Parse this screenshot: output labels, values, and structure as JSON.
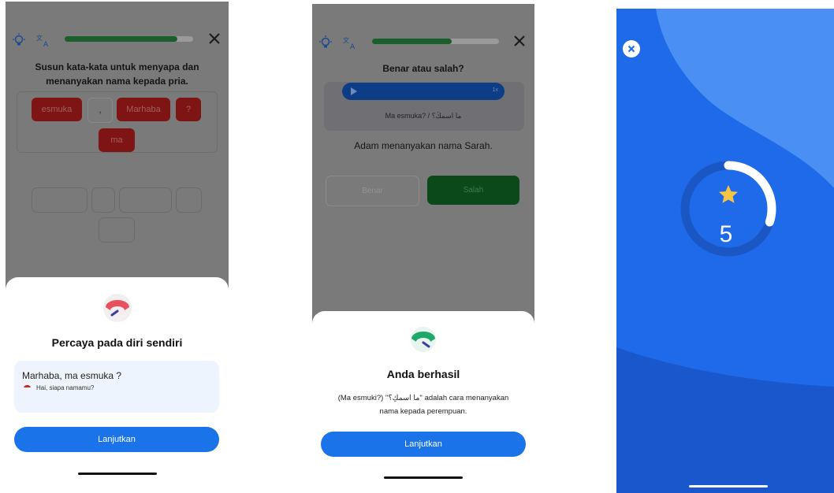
{
  "screen1": {
    "progress": 0.88,
    "instruction_line1": "Susun kata-kata untuk menyapa dan",
    "instruction_line2": "menanyakan nama kepada pria.",
    "word_chips": [
      "esmuka",
      ",",
      "Marhaba",
      "?",
      "ma"
    ],
    "sheet": {
      "title": "Percaya pada diri sendiri",
      "phrase": "Marhaba, ma esmuka ?",
      "translation": "Hai, siapa namamu?",
      "button": "Lanjutkan"
    }
  },
  "screen2": {
    "progress": 0.63,
    "question": "Benar atau salah?",
    "audio_speed": "1x",
    "audio_text": "Ma esmuka? / ما اسمكَ؟",
    "statement": "Adam menanyakan nama Sarah.",
    "choices": [
      "Benar",
      "Salah"
    ],
    "sheet": {
      "title": "Anda berhasil",
      "explanation_line1": "(Ma esmuki?) ''ما اسمكِ؟'' adalah cara menanyakan",
      "explanation_line2": "nama kepada perempuan.",
      "button": "Lanjutkan"
    }
  },
  "screen3": {
    "score": "5",
    "progress": 0.3
  },
  "colors": {
    "accent_blue": "#1a73e8",
    "progress_green": "#1b5e2b",
    "chip_red": "#7e1414",
    "streak_blue": "#1f6ae8"
  },
  "icons": [
    "lightbulb-icon",
    "translate-icon",
    "close-icon",
    "play-icon",
    "star-icon",
    "gauge-icon",
    "flag-icon"
  ]
}
